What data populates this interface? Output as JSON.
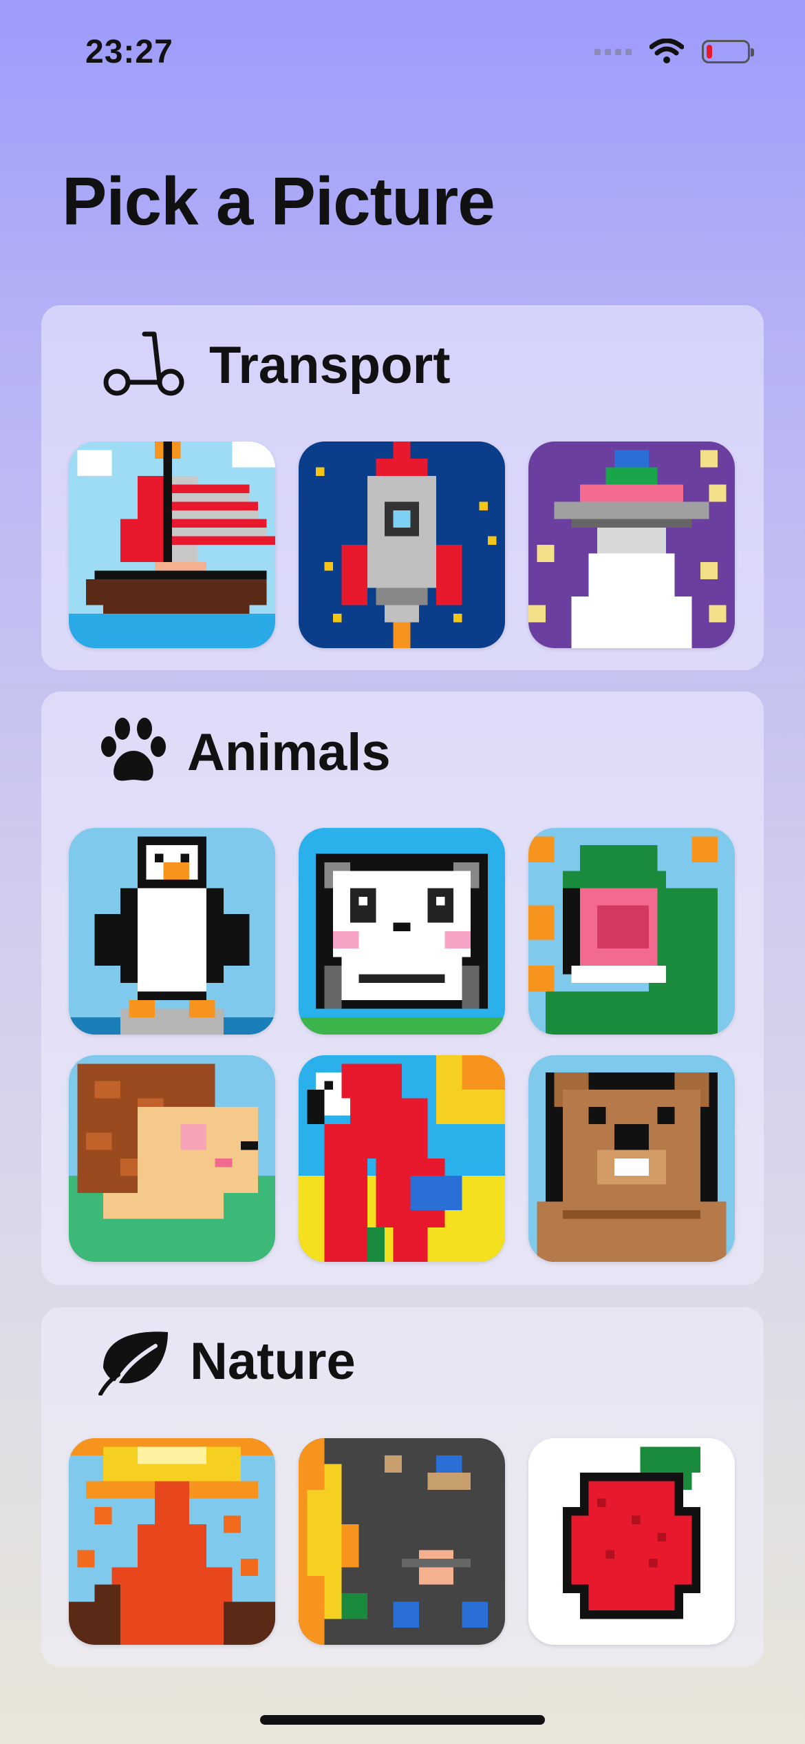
{
  "status": {
    "time": "23:27",
    "icons": [
      "signal-icon",
      "wifi-icon",
      "battery-icon"
    ]
  },
  "title": "Pick a Picture",
  "sections": [
    {
      "label": "Transport",
      "icon": "scooter-icon",
      "pictures": [
        "sailboat",
        "rocket",
        "ufo"
      ]
    },
    {
      "label": "Animals",
      "icon": "paw-icon",
      "pictures": [
        "penguin",
        "panda",
        "crocodile",
        "hedgehog",
        "parrot",
        "beaver"
      ]
    },
    {
      "label": "Nature",
      "icon": "leaf-icon",
      "pictures": [
        "volcano",
        "space-planets",
        "strawberry"
      ]
    }
  ]
}
